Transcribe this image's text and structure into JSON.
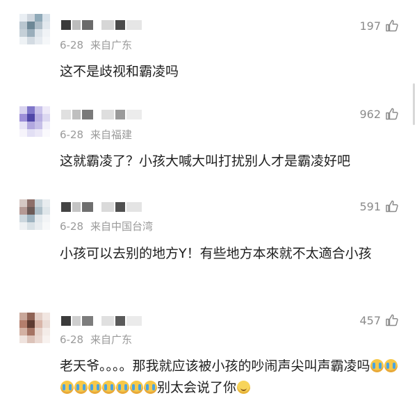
{
  "comments": [
    {
      "date": "6-28",
      "location": "来自广东",
      "likes": "197",
      "text": "这不是歧视和霸凌吗",
      "avatar_colors": [
        "#e9eef3",
        "#cfd6de",
        "#8fa9b8",
        "#d9e2ea",
        "#b9c6d0",
        "#6d8796",
        "#aebdc8",
        "#e2e8ee",
        "#c5d0d8",
        "#9aaebb",
        "#dde4ea",
        "#f0f3f6",
        "#eef2f5",
        "#d3dbe2",
        "#e6ebf0",
        "#f5f7f9"
      ],
      "name_colors": [
        "#3a3a3a",
        "#bdbdbd",
        "#6b6b6b",
        "#d6d6d6",
        "#4b4b4b",
        "#e6e6e6"
      ]
    },
    {
      "date": "6-28",
      "location": "来自福建",
      "likes": "962",
      "text": "这就霸凌了？小孩大喊大叫打扰别人才是霸凌好吧",
      "avatar_colors": [
        "#d8d3ef",
        "#7f76c9",
        "#c9c2ea",
        "#eeeaf8",
        "#9d8fd8",
        "#4f46a8",
        "#b9b0e2",
        "#dcd8f1",
        "#e7e3f6",
        "#b2a8df",
        "#c6bfe8",
        "#f2f0fa",
        "#f6f4fb",
        "#e2dff4",
        "#ebe8f7",
        "#faf9fd"
      ],
      "name_colors": [
        "#e0e0e0",
        "#bfbfbf",
        "#7a7a7a",
        "#dedede",
        "#9a9a9a",
        "#ececec"
      ]
    },
    {
      "date": "6-28",
      "location": "来自中国台湾",
      "likes": "591",
      "text": "小孩可以去别的地方Y！有些地方本來就不太適合小孩",
      "avatar_colors": [
        "#d6c8c4",
        "#8d6f6a",
        "#c7d3da",
        "#e8ecef",
        "#b59a95",
        "#6c5a57",
        "#aebfc9",
        "#dfe6ea",
        "#ccd7de",
        "#9eb3c0",
        "#e3e9ed",
        "#f2f4f6",
        "#eef1f3",
        "#d9e1e6",
        "#e9edf0",
        "#f7f8f9"
      ],
      "name_colors": [
        "#444444",
        "#c4c4c4",
        "#6f6f6f",
        "#dadada",
        "#505050",
        "#e4e4e4"
      ]
    },
    {
      "date": "6-28",
      "location": "来自广东",
      "likes": "457",
      "text_parts": [
        "老天爷。。。。那我就应该被小孩的吵闹声尖叫声霸凌吗",
        "别太会说了你"
      ],
      "avatar_colors": [
        "#c9a79a",
        "#8f6355",
        "#e3cfc7",
        "#f1e6e1",
        "#b47e6c",
        "#5e3b31",
        "#d8b5a8",
        "#eadcd6",
        "#d3b1a3",
        "#a57464",
        "#e6d3cb",
        "#f4ece8",
        "#efe3de",
        "#dcc3b9",
        "#ead9d2",
        "#f8f2ef"
      ],
      "name_colors": [
        "#3b3b3b",
        "#cfcfcf",
        "#7d7d7d",
        "#e0e0e0",
        "#5a5a5a",
        "#ebebeb"
      ]
    }
  ],
  "cry_emoji_count": 9,
  "emoji_icons": [
    "loudly-crying-face-icon",
    "smiling-face-icon"
  ],
  "like_icon": "thumbs-up-icon"
}
